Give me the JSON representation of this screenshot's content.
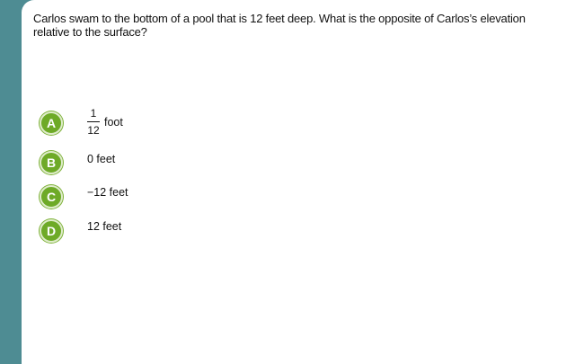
{
  "question": {
    "text": "Carlos swam to the bottom of a pool that is 12 feet deep. What is the opposite of Carlos’s elevation relative to the surface?"
  },
  "choices": [
    {
      "letter": "A",
      "numerator": "1",
      "denominator": "12",
      "unit": "foot"
    },
    {
      "letter": "B",
      "text": "0 feet"
    },
    {
      "letter": "C",
      "text": "−12 feet"
    },
    {
      "letter": "D",
      "text": "12 feet"
    }
  ],
  "colors": {
    "background": "#4e8c93",
    "panel": "#ffffff",
    "badge": "#6eaa27"
  }
}
